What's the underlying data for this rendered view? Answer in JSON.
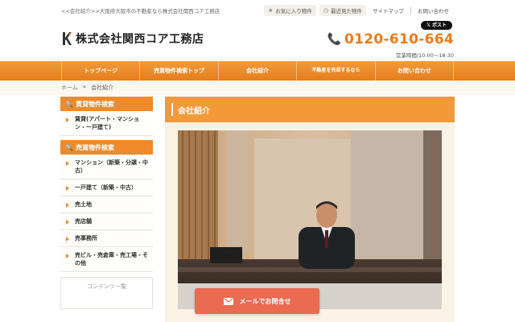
{
  "header": {
    "topline": "<<会社紹介>>大阪府大阪市の不動産なら株式会社関西コア工務店",
    "favorites": "お気に入り物件",
    "recent": "最近見た物件",
    "sitemap": "サイトマップ",
    "contact": "お問い合わせ",
    "xpost": "𝕏 ポスト",
    "company_name": "株式会社関西コア工務店",
    "phone": "0120-610-664",
    "hours": "営業時間/10:00〜18:30"
  },
  "nav": {
    "items": [
      {
        "label": "トップページ"
      },
      {
        "label": "売買物件検索トップ"
      },
      {
        "label": "会社紹介"
      },
      {
        "label": "不動産を売却するなら"
      },
      {
        "label": "お問い合わせ"
      }
    ]
  },
  "breadcrumb": {
    "home": "ホーム",
    "sep": "»",
    "current": "会社紹介"
  },
  "sidebar": {
    "rental_heading": "賃貸物件検索",
    "rental_items": [
      {
        "label": "賃貸(アパート・マンション・一戸建て)"
      }
    ],
    "sale_heading": "売買物件検索",
    "sale_items": [
      {
        "label": "マンション（新築・分譲・中古）"
      },
      {
        "label": "一戸建て（新築・中古）"
      },
      {
        "label": "売土地"
      },
      {
        "label": "売店舗"
      },
      {
        "label": "売事務所"
      },
      {
        "label": "売ビル・売倉庫・売工場・その他"
      }
    ],
    "contents_heading": "コンテンツ一覧"
  },
  "main": {
    "title": "会社紹介"
  },
  "cta": {
    "mail_label": "メールでお問合せ"
  },
  "colors": {
    "brand_orange": "#ee8a2a",
    "phone_orange": "#ef7a1a",
    "cta_red": "#ea6a52"
  }
}
